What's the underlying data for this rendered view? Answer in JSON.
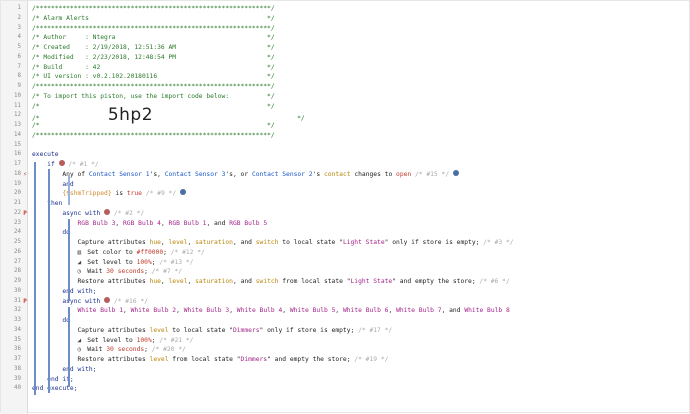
{
  "editor": {
    "lines": [
      {
        "n": "1",
        "mark": "",
        "html": "<span class='c-comment'>/**************************************************************/</span>"
      },
      {
        "n": "2",
        "mark": "",
        "html": "<span class='c-comment'>/* Alarm Alerts                                               */</span>"
      },
      {
        "n": "3",
        "mark": "",
        "html": "<span class='c-comment'>/**************************************************************/</span>"
      },
      {
        "n": "4",
        "mark": "",
        "html": "<span class='c-comment'>/* Author     : Ntegra                                        */</span>"
      },
      {
        "n": "5",
        "mark": "",
        "html": "<span class='c-comment'>/* Created    : 2/19/2018, 12:51:36 AM                        */</span>"
      },
      {
        "n": "6",
        "mark": "",
        "html": "<span class='c-comment'>/* Modified   : 2/23/2018, 12:48:54 PM                        */</span>"
      },
      {
        "n": "7",
        "mark": "",
        "html": "<span class='c-comment'>/* Build      : 42                                            */</span>"
      },
      {
        "n": "8",
        "mark": "",
        "html": "<span class='c-comment'>/* UI version : v0.2.102.20180116                             */</span>"
      },
      {
        "n": "9",
        "mark": "",
        "html": "<span class='c-comment'>/**************************************************************/</span>"
      },
      {
        "n": "10",
        "mark": "",
        "html": "<span class='c-comment'>/* To import this piston, use the import code below:          */</span>"
      },
      {
        "n": "11",
        "mark": "",
        "html": "<span class='c-comment'>/*                                                            */</span>"
      },
      {
        "n": "12",
        "mark": "",
        "html": "<span class='c-comment'>/*                  </span><span class='big'>5hp2</span><span class='c-comment'>                                      */</span>"
      },
      {
        "n": "13",
        "mark": "",
        "html": "<span class='c-comment'>/*                                                            */</span>"
      },
      {
        "n": "14",
        "mark": "",
        "html": "<span class='c-comment'>/**************************************************************/</span>"
      },
      {
        "n": "15",
        "mark": "",
        "html": ""
      },
      {
        "n": "16",
        "mark": "",
        "html": "<span class='c-kw'>execute</span>"
      },
      {
        "n": "17",
        "mark": "",
        "html": "    <span class='c-kw'>if</span> <span class='badge'></span> <span class='c-dim'>/* #1 */</span>"
      },
      {
        "n": "18",
        "mark": "⚡",
        "html": "        Any of <span class='c-dev'>Contact Sensor 1</span>'s, <span class='c-dev'>Contact Sensor 3</span>'s, or <span class='c-dev'>Contact Sensor 2</span>'s <span class='c-attr'>contact</span> changes to <span class='c-val'>open</span> <span class='c-dim'>/* #15 */</span> <span class='gear-badge'></span>"
      },
      {
        "n": "19",
        "mark": "",
        "html": "        <span class='c-kw'>and</span>"
      },
      {
        "n": "20",
        "mark": "",
        "html": "        <span class='c-var'>{$shmTripped}</span> is <span class='c-val'>true</span> <span class='c-dim'>/* #9 */</span> <span class='gear-badge'></span>"
      },
      {
        "n": "21",
        "mark": "",
        "html": "    <span class='c-kw'>then</span>"
      },
      {
        "n": "22",
        "mark": "P",
        "html": "        <span class='c-kw'>async with</span> <span class='badge'></span> <span class='c-dim'>/* #2 */</span>"
      },
      {
        "n": "23",
        "mark": "",
        "html": "            <span class='c-str'>RGB Bulb 3</span>, <span class='c-str'>RGB Bulb 4</span>, <span class='c-str'>RGB Bulb 1</span>, and <span class='c-str'>RGB Bulb 5</span>"
      },
      {
        "n": "24",
        "mark": "",
        "html": "        <span class='c-kw'>do</span>"
      },
      {
        "n": "25",
        "mark": "",
        "html": "            Capture attributes <span class='c-attr'>hue</span>, <span class='c-attr'>level</span>, <span class='c-attr'>saturation</span>, and <span class='c-attr'>switch</span> to local state \"<span class='c-str'>Light State</span>\" only if store is empty; <span class='c-dim'>/* #3 */</span>"
      },
      {
        "n": "26",
        "mark": "",
        "html": "            <span class='ico'>▥</span> Set color to <span class='c-val'>#ff0000</span>; <span class='c-dim'>/* #12 */</span>"
      },
      {
        "n": "27",
        "mark": "",
        "html": "            <span class='ico'>◢</span> Set level to <span class='c-val'>100%</span>; <span class='c-dim'>/* #13 */</span>"
      },
      {
        "n": "28",
        "mark": "",
        "html": "            <span class='ico'>◷</span> Wait <span class='c-val'>30 seconds</span>; <span class='c-dim'>/* #7 */</span>"
      },
      {
        "n": "29",
        "mark": "",
        "html": "            Restore attributes <span class='c-attr'>hue</span>, <span class='c-attr'>level</span>, <span class='c-attr'>saturation</span>, and <span class='c-attr'>switch</span> from local state \"<span class='c-str'>Light State</span>\" and empty the store; <span class='c-dim'>/* #6 */</span>"
      },
      {
        "n": "30",
        "mark": "",
        "html": "        <span class='c-kw'>end with;</span>"
      },
      {
        "n": "31",
        "mark": "P",
        "html": "        <span class='c-kw'>async with</span> <span class='badge'></span> <span class='c-dim'>/* #16 */</span>"
      },
      {
        "n": "32",
        "mark": "",
        "html": "            <span class='c-str'>White Bulb 1</span>, <span class='c-str'>White Bulb 2</span>, <span class='c-str'>White Bulb 3</span>, <span class='c-str'>White Bulb 4</span>, <span class='c-str'>White Bulb 5</span>, <span class='c-str'>White Bulb 6</span>, <span class='c-str'>White Bulb 7</span>, and <span class='c-str'>White Bulb 8</span>"
      },
      {
        "n": "33",
        "mark": "",
        "html": "        <span class='c-kw'>do</span>"
      },
      {
        "n": "34",
        "mark": "",
        "html": "            Capture attributes <span class='c-attr'>level</span> to local state \"<span class='c-str'>Dimmers</span>\" only if store is empty; <span class='c-dim'>/* #17 */</span>"
      },
      {
        "n": "35",
        "mark": "",
        "html": "            <span class='ico'>◢</span> Set level to <span class='c-val'>100%</span>; <span class='c-dim'>/* #21 */</span>"
      },
      {
        "n": "36",
        "mark": "",
        "html": "            <span class='ico'>◷</span> Wait <span class='c-val'>30 seconds</span>; <span class='c-dim'>/* #20 */</span>"
      },
      {
        "n": "37",
        "mark": "",
        "html": "            Restore attributes <span class='c-attr'>level</span> from local state \"<span class='c-str'>Dimmers</span>\" and empty the store; <span class='c-dim'>/* #19 */</span>"
      },
      {
        "n": "38",
        "mark": "",
        "html": "        <span class='c-kw'>end with;</span>"
      },
      {
        "n": "39",
        "mark": "",
        "html": "    <span class='c-kw'>end if;</span>"
      },
      {
        "n": "40",
        "mark": "",
        "html": "<span class='c-kw'>end execute;</span>"
      }
    ]
  }
}
